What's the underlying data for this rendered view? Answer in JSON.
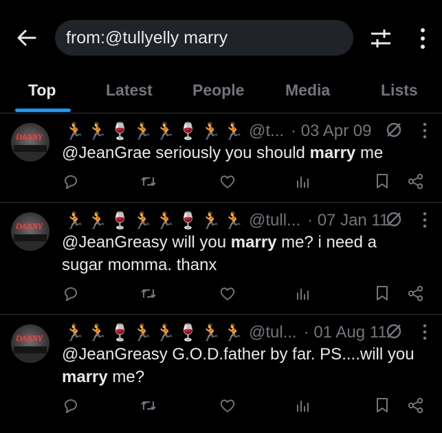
{
  "search": {
    "query": "from:@tullyelly marry"
  },
  "icons": {
    "back": "arrow-left-icon",
    "filter": "sliders-icon",
    "more": "more-vertical-icon",
    "reply": "reply-icon",
    "retweet": "retweet-icon",
    "like": "heart-icon",
    "views": "views-icon",
    "bookmark": "bookmark-icon",
    "share": "share-icon",
    "edit": "no-edit-icon"
  },
  "colors": {
    "accent": "#1d9bf0",
    "background": "#000000",
    "muted": "#71767b"
  },
  "tabs": [
    {
      "label": "Top",
      "active": true
    },
    {
      "label": "Latest"
    },
    {
      "label": "People"
    },
    {
      "label": "Media"
    },
    {
      "label": "Lists"
    }
  ],
  "tweets": [
    {
      "avatar_text": "DANNY",
      "name_emojis": [
        "🏃",
        "🏃",
        "🍷",
        "🏃",
        "🏃",
        "🍷",
        "🏃",
        "🏃"
      ],
      "handle": "@t...",
      "date": "· 03 Apr 09",
      "text_pre": "@JeanGrae seriously you should ",
      "text_bold": "marry",
      "text_post": " me",
      "text_post2": ""
    },
    {
      "avatar_text": "DANNY",
      "name_emojis": [
        "🏃",
        "🏃",
        "🍷",
        "🏃",
        "🏃",
        "🍷",
        "🏃",
        "🏃"
      ],
      "handle": "@tull...",
      "date": "· 07 Jan 11",
      "text_pre": "@JeanGreasy will you ",
      "text_bold": "marry",
      "text_post": " me? i need a",
      "text_post2": "sugar momma. thanx"
    },
    {
      "avatar_text": "DANNY",
      "name_emojis": [
        "🏃",
        "🏃",
        "🍷",
        "🏃",
        "🏃",
        "🍷",
        "🏃",
        "🏃"
      ],
      "handle": "@tul...",
      "date": "· 01 Aug 11",
      "text_pre": "@JeanGreasy G.O.D.father by far. PS....will you",
      "text_bold": "marry",
      "text_post": " me?",
      "text_post2": ""
    }
  ]
}
